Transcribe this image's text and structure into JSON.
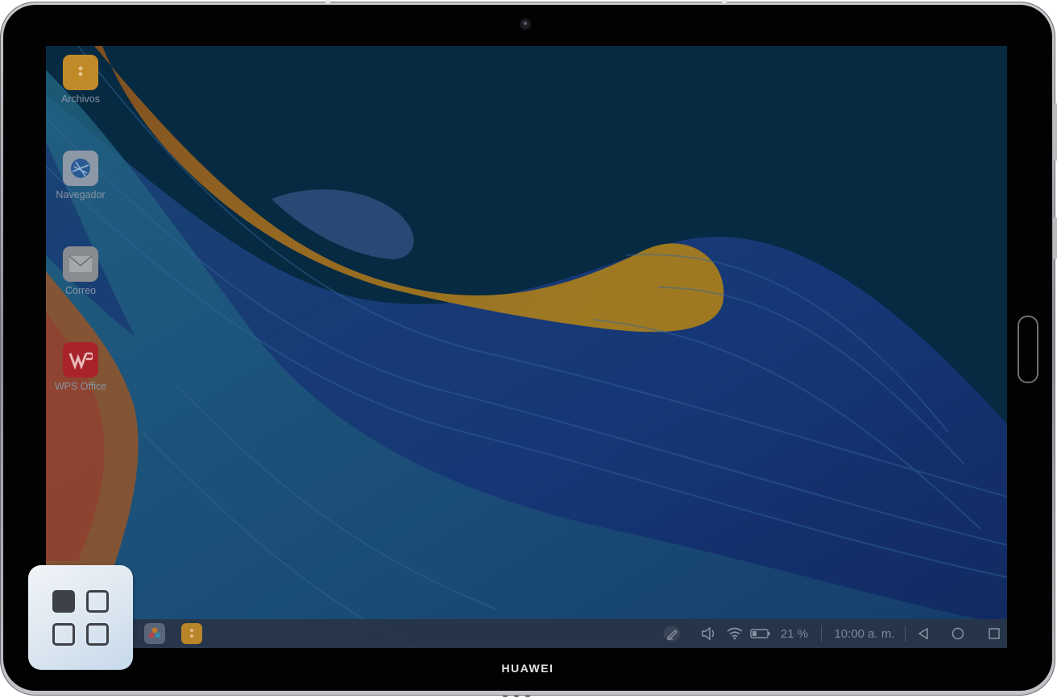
{
  "device": {
    "brand": "HUAWEI"
  },
  "desktop_icons": [
    {
      "name": "files",
      "label": "Archivos",
      "icon": "folder-icon",
      "color": "#c9902a"
    },
    {
      "name": "browser",
      "label": "Navegador",
      "icon": "globe-icon",
      "color": "#8d9aa8"
    },
    {
      "name": "mail",
      "label": "Correo",
      "icon": "envelope-icon",
      "color": "#8b8e93"
    },
    {
      "name": "wps",
      "label": "WPS Office",
      "icon": "wps-icon",
      "color": "#b0262b"
    }
  ],
  "taskbar": {
    "pinned": [
      {
        "name": "gallery",
        "icon": "gallery-icon"
      },
      {
        "name": "files",
        "icon": "folder-icon"
      }
    ],
    "battery": "21 %",
    "time": "10:00 a. m.",
    "icons": [
      "pen-icon",
      "volume-icon",
      "wifi-icon",
      "battery-icon",
      "back-icon",
      "home-icon",
      "recents-icon"
    ]
  },
  "overlay": {
    "icon": "apps-grid-icon"
  },
  "colors": {
    "screen_bg": "#07304a",
    "taskbar": "#28344a",
    "accent_orange": "#d4781c"
  }
}
